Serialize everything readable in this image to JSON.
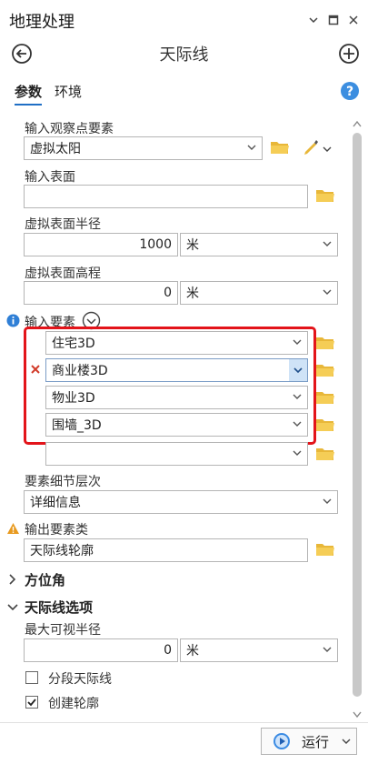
{
  "panel": {
    "title": "地理处理",
    "tool_title": "天际线",
    "tabs": [
      "参数",
      "环境"
    ]
  },
  "params": {
    "observer_label": "输入观察点要素",
    "observer_value": "虚拟太阳",
    "surface_label": "输入表面",
    "surface_value": "",
    "radius_label": "虚拟表面半径",
    "radius_value": "1000",
    "radius_unit": "米",
    "elevation_label": "虚拟表面高程",
    "elevation_value": "0",
    "elevation_unit": "米",
    "features_label": "输入要素",
    "features": [
      "住宅3D",
      "商业楼3D",
      "物业3D",
      "围墙_3D",
      ""
    ],
    "lod_label": "要素细节层次",
    "lod_value": "详细信息",
    "output_label": "输出要素类",
    "output_value": "天际线轮廓",
    "azimuth_section": "方位角",
    "skyline_section": "天际线选项",
    "max_radius_label": "最大可视半径",
    "max_radius_value": "0",
    "max_radius_unit": "米",
    "segment_label": "分段天际线",
    "segment_checked": false,
    "silhouette_label": "创建轮廓",
    "silhouette_checked": true
  },
  "run": {
    "label": "运行"
  },
  "colors": {
    "accent": "#1f6fc5",
    "highlight_border": "#e3141a",
    "folder": "#e8b739",
    "remove_x": "#d23b2a",
    "warning": "#e89a20"
  }
}
